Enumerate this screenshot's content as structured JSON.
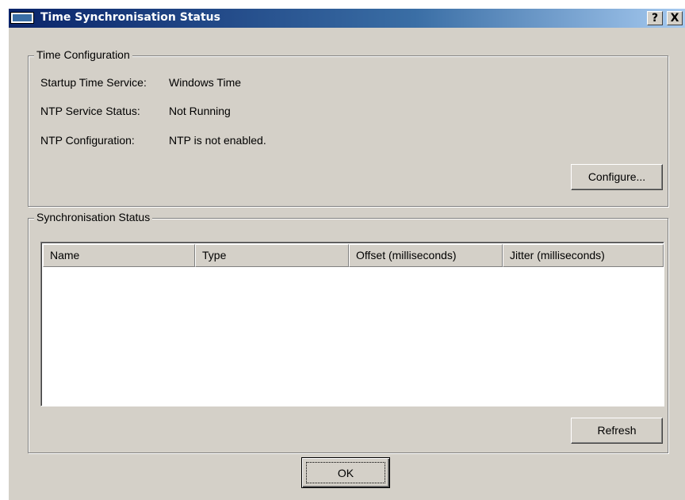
{
  "window": {
    "title": "Time Synchronisation Status",
    "help_label": "?",
    "close_label": "X"
  },
  "time_config": {
    "legend": "Time Configuration",
    "rows": [
      {
        "label": "Startup Time Service:",
        "value": "Windows Time"
      },
      {
        "label": "NTP Service Status:",
        "value": "Not Running"
      },
      {
        "label": "NTP Configuration:",
        "value": "NTP is not enabled."
      }
    ],
    "configure_label": "Configure..."
  },
  "sync_status": {
    "legend": "Synchronisation Status",
    "columns": [
      "Name",
      "Type",
      "Offset (milliseconds)",
      "Jitter (milliseconds)"
    ],
    "rows": [],
    "refresh_label": "Refresh"
  },
  "footer": {
    "ok_label": "OK"
  },
  "colors": {
    "dialog_face": "#d4d0c8",
    "title_gradient_start": "#0a246a",
    "title_gradient_end": "#a6caf0"
  }
}
